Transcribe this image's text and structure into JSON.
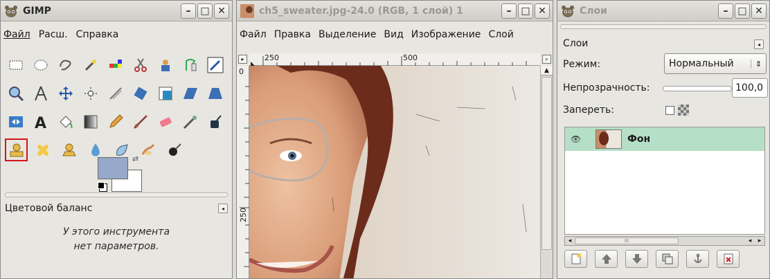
{
  "toolbox": {
    "title": "GIMP",
    "menu": [
      "Файл",
      "Расш.",
      "Справка"
    ],
    "active_tool": "color-balance",
    "options_title": "Цветовой баланс",
    "options_text_line1": "У этого инструмента",
    "options_text_line2": "нет параметров.",
    "fg_color": "#97a9cb",
    "bg_color": "#ffffff"
  },
  "image_window": {
    "title": "ch5_sweater.jpg-24.0 (RGB, 1 слой) 1",
    "menu": [
      "Файл",
      "Правка",
      "Выделение",
      "Вид",
      "Изображение",
      "Слой"
    ],
    "ruler_h_labels": [
      "250",
      "500"
    ],
    "ruler_v_label": "250"
  },
  "layers": {
    "title": "Слои",
    "tab_label": "Слои",
    "mode_label": "Режим:",
    "mode_value": "Нормальный",
    "opacity_label": "Непрозрачность:",
    "opacity_value": "100,0",
    "lock_label": "Запереть:",
    "layer_name": "Фон",
    "scroll_mark": "III"
  },
  "colors": {
    "selection_highlight": "#d0161a",
    "layer_row": "#b5dfc6",
    "titlebar": "#d8d6d1"
  }
}
